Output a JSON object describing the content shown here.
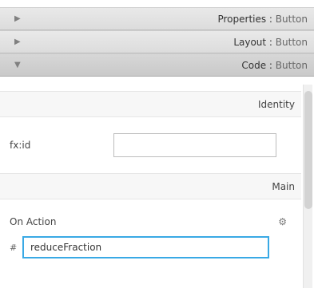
{
  "accordion": {
    "items": [
      {
        "arrow": "▶",
        "title": "Properties : ",
        "type": "Button"
      },
      {
        "arrow": "▶",
        "title": "Layout : ",
        "type": "Button"
      },
      {
        "arrow": "▼",
        "title": "Code : ",
        "type": "Button"
      }
    ]
  },
  "code_pane": {
    "identity_section": "Identity",
    "main_section": "Main",
    "fx_id_label": "fx:id",
    "fx_id_value": "",
    "on_action_label": "On Action",
    "on_action_gear": "⚙",
    "hash_label": "#",
    "on_action_value": "reduceFraction"
  },
  "icons": {
    "collapsed_arrow": "right-triangle",
    "expanded_arrow": "down-triangle",
    "settings": "gear"
  }
}
